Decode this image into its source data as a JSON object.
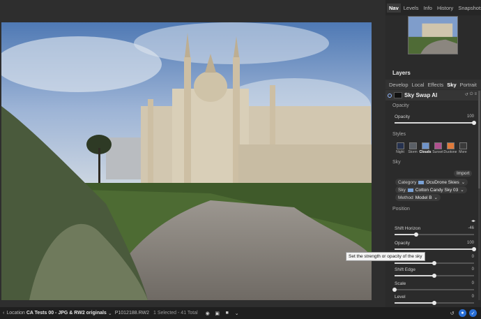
{
  "bottombar": {
    "location_label": "Location",
    "location": "CA Tests 00 - JPG & RW2 originals",
    "filename": "P1012188.RW2",
    "selection": "1 Selected - 41 Total"
  },
  "top_tabs": [
    "Nav",
    "Levels",
    "Info",
    "History",
    "Snapshots"
  ],
  "layers_title": "Layers",
  "module_tabs": [
    "Develop",
    "Local",
    "Effects",
    "Sky",
    "Portrait"
  ],
  "layer": {
    "name": "Sky Swap AI"
  },
  "sections": {
    "opacity": "Opacity",
    "styles": "Styles",
    "sky": "Sky",
    "position": "Position"
  },
  "sliders": {
    "opacity_top": {
      "label": "Opacity",
      "value": "100",
      "level": 1.0
    },
    "shift_horizon": {
      "label": "Shift Horizon",
      "value": "-46",
      "level": 0.27
    },
    "opacity": {
      "label": "Opacity",
      "value": "100",
      "level": 1.0
    },
    "feather": {
      "label": "",
      "value": "0",
      "level": 0.5
    },
    "shift_edge": {
      "label": "Shift Edge",
      "value": "0",
      "level": 0.5
    },
    "scale": {
      "label": "Scale",
      "value": "0",
      "level": 0.0
    },
    "level": {
      "label": "Level",
      "value": "0",
      "level": 0.5
    }
  },
  "styles": [
    {
      "label": "Night",
      "color": "#26324f"
    },
    {
      "label": "Storm",
      "color": "#5a5f66"
    },
    {
      "label": "Clouds",
      "color": "#6f93c8"
    },
    {
      "label": "Sunset",
      "color": "#b0508f"
    },
    {
      "label": "Duotone",
      "color": "#e07a3a"
    },
    {
      "label": "More",
      "color": "#3a3a3a"
    }
  ],
  "sky": {
    "import_label": "Import",
    "category_label": "Category",
    "category_value": "OcuDrone Skies",
    "sky_label": "Sky",
    "sky_value": "Cotton Candy Sky 03",
    "method_label": "Method",
    "method_value": "Model B"
  },
  "tooltip": "Set the strength or opacity of the sky"
}
